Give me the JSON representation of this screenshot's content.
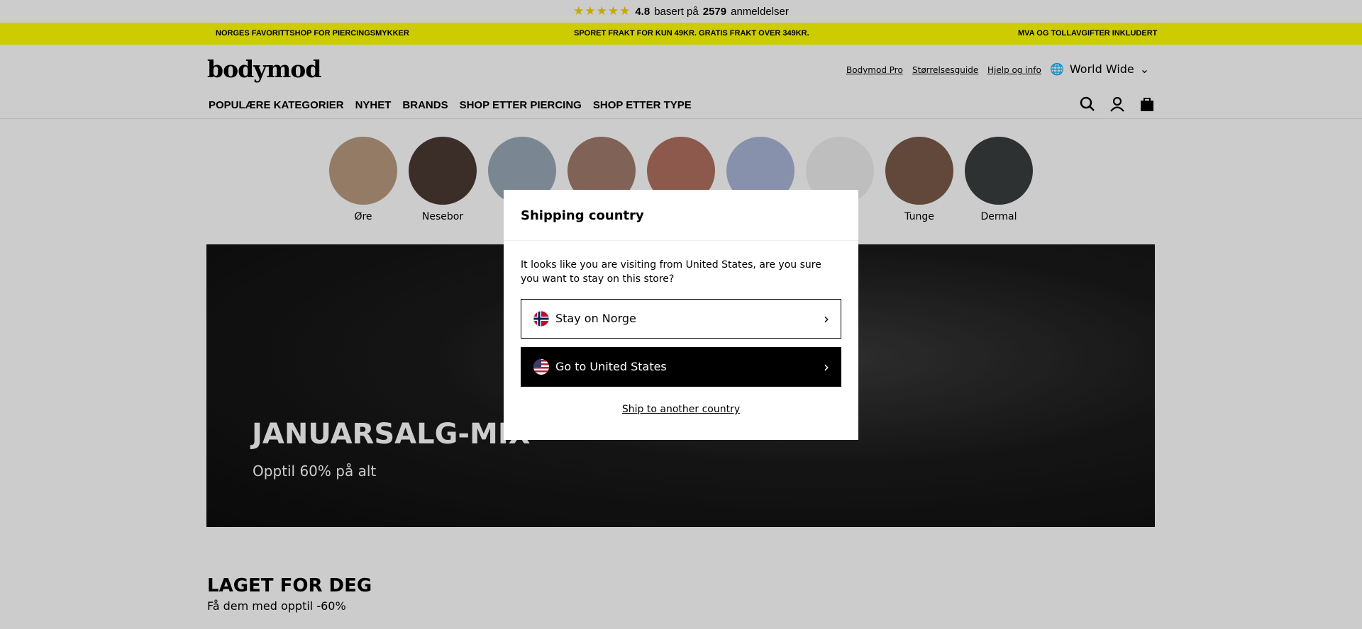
{
  "rating": {
    "stars": "★★★★★",
    "score": "4.8",
    "text1": "basert på",
    "count": "2579",
    "text2": "anmeldelser"
  },
  "promo": [
    "NORGES FAVORITTSHOP FOR PIERCINGSMYKKER",
    "SPORET FRAKT FOR KUN 49KR. GRATIS FRAKT OVER 349KR.",
    "MVA OG TOLLAVGIFTER INKLUDERT"
  ],
  "header": {
    "logo": "bodymod",
    "links": [
      "Bodymod Pro",
      "Størrelsesguide",
      "Hjelp og info"
    ],
    "region": "World Wide"
  },
  "nav": [
    "POPULÆRE KATEGORIER",
    "NYHET",
    "BRANDS",
    "SHOP ETTER PIERCING",
    "SHOP ETTER TYPE"
  ],
  "categories": [
    {
      "label": "Øre",
      "color": "#b89a80"
    },
    {
      "label": "Nesebor",
      "color": "#4a3a34"
    },
    {
      "label": "",
      "color": "#9aa8b8"
    },
    {
      "label": "",
      "color": "#a07c6c"
    },
    {
      "label": "",
      "color": "#b07060"
    },
    {
      "label": "",
      "color": "#aab6d6"
    },
    {
      "label": "",
      "color": "#eeeeee"
    },
    {
      "label": "Tunge",
      "color": "#7a5a4a"
    },
    {
      "label": "Dermal",
      "color": "#3a3e3e"
    }
  ],
  "hero": {
    "title": "JANUARSALG-MIX",
    "subtitle": "Opptil 60% på alt"
  },
  "section": {
    "title": "LAGET FOR DEG",
    "subtitle": "Få dem med opptil -60%"
  },
  "modal": {
    "title": "Shipping country",
    "message": "It looks like you are visiting from United States, are you sure you want to stay on this store?",
    "stay": "Stay on Norge",
    "go": "Go to United States",
    "other": "Ship to another country"
  }
}
